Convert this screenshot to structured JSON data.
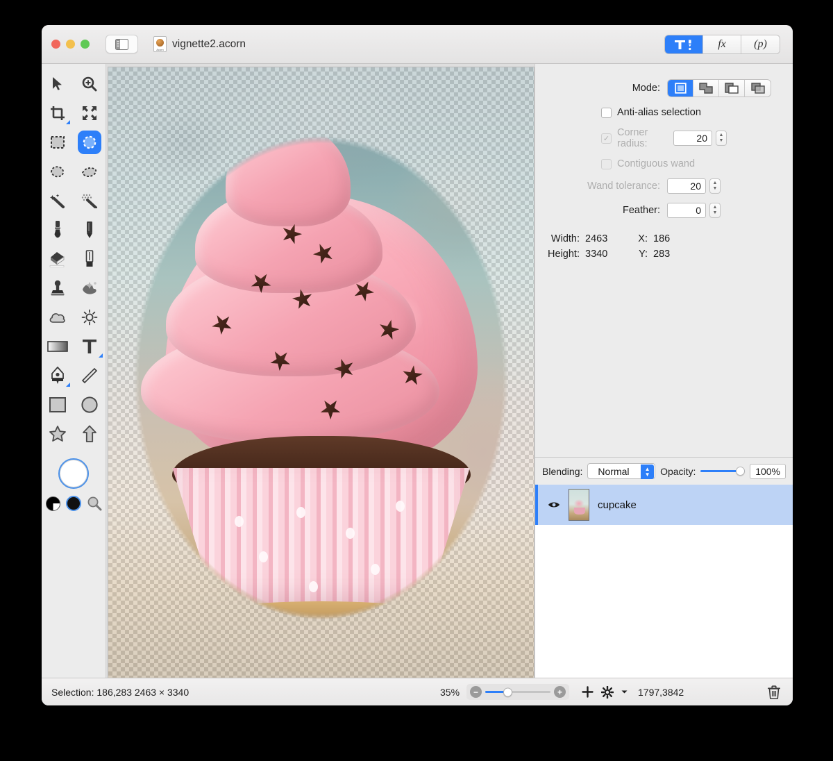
{
  "window": {
    "traffic_lights": [
      "close",
      "minimize",
      "zoom"
    ],
    "sidebar_toggle_icon": "sidebar-toggle-icon",
    "document_name": "vignette2.acorn",
    "document_icon_label": "Acorn"
  },
  "toolbar_tabs": [
    {
      "label": "",
      "icon": "tools-icon",
      "active": true
    },
    {
      "label": "fx",
      "icon": "filters-icon",
      "active": false
    },
    {
      "label": "(p)",
      "icon": "presets-icon",
      "active": false
    }
  ],
  "tools": [
    {
      "name": "move-tool",
      "icon": "arrow-cursor-icon",
      "selected": false
    },
    {
      "name": "zoom-tool",
      "icon": "magnifier-plus-icon",
      "selected": false
    },
    {
      "name": "crop-tool",
      "icon": "crop-icon",
      "selected": false,
      "has_submenu": true
    },
    {
      "name": "transform-tool",
      "icon": "move-arrows-icon",
      "selected": false
    },
    {
      "name": "rectangular-select-tool",
      "icon": "marquee-rect-icon",
      "selected": false
    },
    {
      "name": "elliptical-select-tool",
      "icon": "marquee-ellipse-icon",
      "selected": true
    },
    {
      "name": "lasso-tool",
      "icon": "lasso-icon",
      "selected": false
    },
    {
      "name": "polygon-lasso-tool",
      "icon": "polygon-lasso-icon",
      "selected": false
    },
    {
      "name": "magic-wand-tool",
      "icon": "magic-wand-icon",
      "selected": false
    },
    {
      "name": "instant-alpha-tool",
      "icon": "instant-alpha-icon",
      "selected": false
    },
    {
      "name": "brush-tool",
      "icon": "brush-icon",
      "selected": false
    },
    {
      "name": "pencil-tool",
      "icon": "pencil-icon",
      "selected": false
    },
    {
      "name": "eraser-tool",
      "icon": "eraser-icon",
      "selected": false
    },
    {
      "name": "marker-tool",
      "icon": "marker-icon",
      "selected": false
    },
    {
      "name": "clone-stamp-tool",
      "icon": "clone-stamp-icon",
      "selected": false
    },
    {
      "name": "smudge-tool",
      "icon": "smudge-icon",
      "selected": false
    },
    {
      "name": "blur-tool",
      "icon": "cloud-blur-icon",
      "selected": false
    },
    {
      "name": "dodge-tool",
      "icon": "sun-dodge-icon",
      "selected": false
    },
    {
      "name": "gradient-tool",
      "icon": "gradient-icon",
      "selected": false
    },
    {
      "name": "text-tool",
      "icon": "text-t-icon",
      "selected": false,
      "has_submenu": true
    },
    {
      "name": "bezier-pen-tool",
      "icon": "pen-nib-icon",
      "selected": false,
      "has_submenu": true
    },
    {
      "name": "line-tool",
      "icon": "line-icon",
      "selected": false
    },
    {
      "name": "rectangle-shape-tool",
      "icon": "rectangle-icon",
      "selected": false
    },
    {
      "name": "ellipse-shape-tool",
      "icon": "ellipse-icon",
      "selected": false
    },
    {
      "name": "star-shape-tool",
      "icon": "star-icon",
      "selected": false
    },
    {
      "name": "arrow-shape-tool",
      "icon": "arrow-up-icon",
      "selected": false
    }
  ],
  "color_well": {
    "name": "foreground-color-well",
    "color": "#ffffff",
    "ring_color": "#4a90e8"
  },
  "color_extras": [
    {
      "name": "color-mode-swatch",
      "icon": "half-circle-icon"
    },
    {
      "name": "background-color-swatch",
      "icon": "black-circle-icon",
      "color": "#111111"
    },
    {
      "name": "color-picker-magnifier",
      "icon": "magnifier-icon"
    }
  ],
  "inspector": {
    "mode_label": "Mode:",
    "modes": [
      {
        "name": "new-selection-mode",
        "icon": "selection-new-icon",
        "active": true
      },
      {
        "name": "add-selection-mode",
        "icon": "selection-union-icon",
        "active": false
      },
      {
        "name": "subtract-selection-mode",
        "icon": "selection-subtract-icon",
        "active": false
      },
      {
        "name": "intersect-selection-mode",
        "icon": "selection-intersect-icon",
        "active": false
      }
    ],
    "antialias": {
      "label": "Anti-alias selection",
      "checked": false,
      "enabled": true
    },
    "corner_radius": {
      "label": "Corner radius:",
      "checked": true,
      "value": "20",
      "enabled": false
    },
    "contiguous_wand": {
      "label": "Contiguous wand",
      "checked": false,
      "enabled": false
    },
    "wand_tolerance": {
      "label": "Wand tolerance:",
      "value": "20",
      "enabled": false
    },
    "feather": {
      "label": "Feather:",
      "value": "0",
      "enabled": true
    },
    "dims": {
      "width_label": "Width:",
      "width_value": "2463",
      "height_label": "Height:",
      "height_value": "3340",
      "x_label": "X:",
      "x_value": "186",
      "y_label": "Y:",
      "y_value": "283"
    }
  },
  "layers_panel": {
    "blending_label": "Blending:",
    "blending_value": "Normal",
    "opacity_label": "Opacity:",
    "opacity_value": "100%",
    "opacity_percent": 100,
    "layers": [
      {
        "name": "cupcake",
        "visible": true,
        "selected": true,
        "thumbnail": "cupcake-thumbnail"
      }
    ]
  },
  "status_bar": {
    "selection_text": "Selection: 186,283 2463 × 3340",
    "zoom_level": "35%",
    "zoom_out_icon": "zoom-out-icon",
    "zoom_in_icon": "zoom-in-icon",
    "add_layer_icon": "plus-icon",
    "actions_icon": "gear-icon",
    "coordinates": "1797,3842",
    "delete_icon": "trash-icon"
  },
  "colors": {
    "accent": "#2d7ff9",
    "window_bg": "#ececec",
    "selection_row": "#bdd3f5"
  }
}
